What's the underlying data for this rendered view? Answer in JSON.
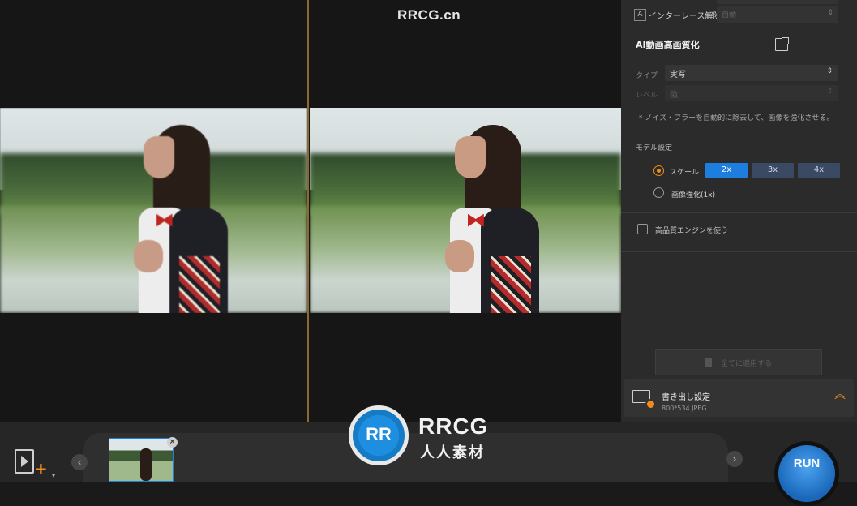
{
  "watermark": {
    "text": "RRCG.cn"
  },
  "deinterlace": {
    "icon_letter": "A",
    "label": "インターレース解除",
    "value": "自動"
  },
  "ai_upscale": {
    "title": "AI動画高画質化",
    "type_label": "タイプ",
    "type_value": "実写",
    "level_label": "レベル",
    "level_value": "強",
    "note": "* ノイズ・ブラーを自動的に除去して、画像を強化させる。",
    "model_label": "モデル設定",
    "scale_label": "スケール",
    "scale_options": [
      "2x",
      "3x",
      "4x"
    ],
    "selected_scale": "2x",
    "enhance_label": "画像強化(1x)",
    "hq_engine_label": "高品質エンジンを使う",
    "apply_all_label": "全てに適用する"
  },
  "export": {
    "title": "書き出し設定",
    "subtitle": "800*534 JPEG"
  },
  "bottom": {
    "prev": "‹",
    "next": "›",
    "close": "×",
    "run_label": "RUN"
  },
  "logo": {
    "mark": "RR",
    "text": "RRCG",
    "sub": "人人素材"
  },
  "colors": {
    "accent_orange": "#f08c1e",
    "accent_blue": "#1e7ee0",
    "panel_bg": "#2b2b2b"
  }
}
